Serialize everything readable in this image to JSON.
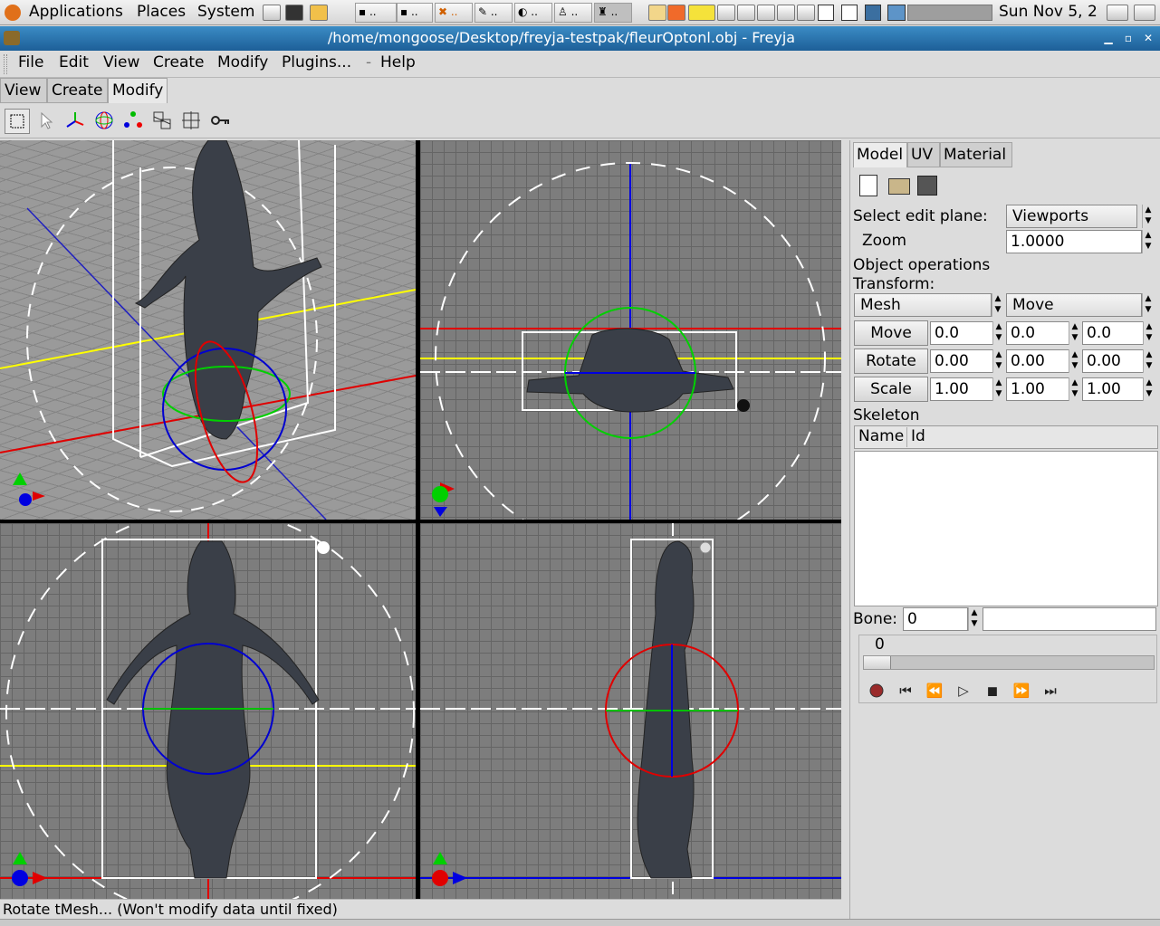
{
  "panel": {
    "applications": "Applications",
    "places": "Places",
    "system": "System",
    "clock": "Sun Nov  5, 2"
  },
  "window": {
    "title": "/home/mongoose/Desktop/freyja-testpak/fleurOptonl.obj - Freyja"
  },
  "menubar": {
    "file": "File",
    "edit": "Edit",
    "view": "View",
    "create": "Create",
    "modify": "Modify",
    "plugins": "Plugins...",
    "help": "Help"
  },
  "tabs": {
    "view": "View",
    "create": "Create",
    "modify": "Modify"
  },
  "right_panel": {
    "tabs": {
      "model": "Model",
      "uv": "UV",
      "material": "Material"
    },
    "select_edit_plane_label": "Select edit plane:",
    "select_edit_plane_value": "Viewports",
    "zoom_label": "Zoom",
    "zoom_value": "1.0000",
    "object_operations": "Object operations",
    "transform": "Transform:",
    "target_value": "Mesh",
    "action_value": "Move",
    "move_label": "Move",
    "rotate_label": "Rotate",
    "scale_label": "Scale",
    "move": [
      "0.0",
      "0.0",
      "0.0"
    ],
    "rotate": [
      "0.00",
      "0.00",
      "0.00"
    ],
    "scale": [
      "1.00",
      "1.00",
      "1.00"
    ],
    "skeleton": "Skeleton",
    "col_name": "Name",
    "col_id": "Id",
    "bone_label": "Bone:",
    "bone_value": "0",
    "frame_value": "0"
  },
  "status": {
    "message": "Rotate tMesh... (Won't modify data until fixed)"
  },
  "colors": {
    "title_bar": "#2a74b0",
    "viewport_bg": "#7d7d7d",
    "axis_red": "#e00000",
    "axis_green": "#00c000",
    "axis_blue": "#0000e0",
    "axis_yellow": "#ffff00"
  }
}
